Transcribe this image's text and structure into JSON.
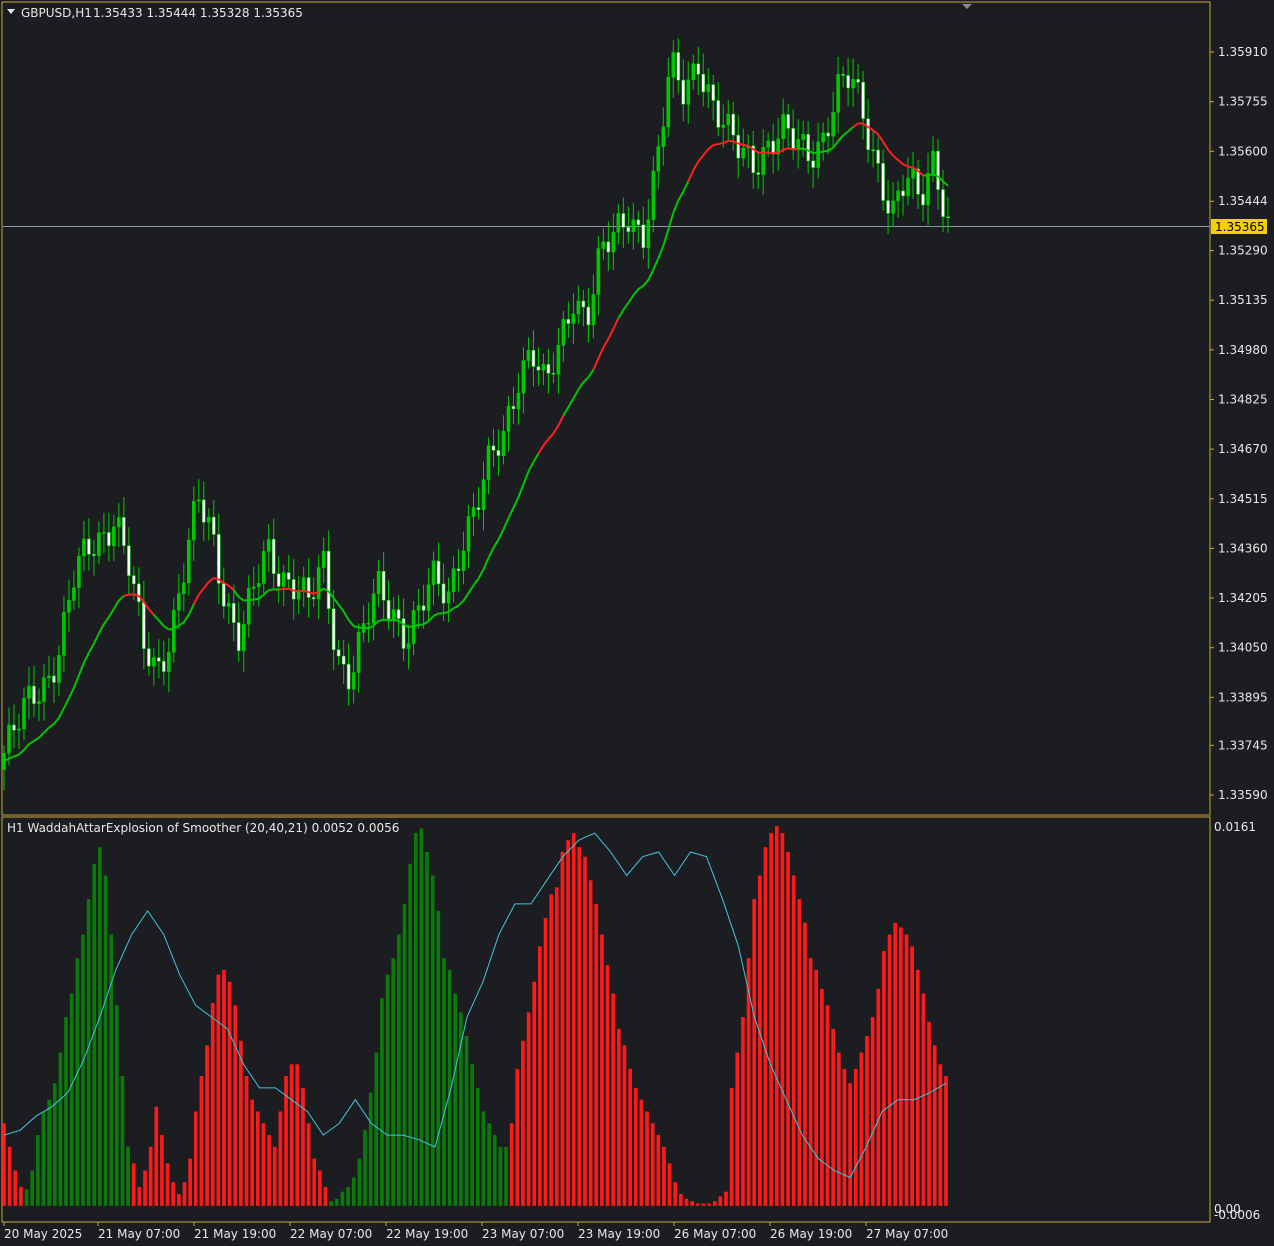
{
  "window": {
    "symbol_label": "GBPUSD,H1",
    "ohlc_label": "1.35433 1.35444 1.35328 1.35365",
    "collapse_icon": "triangle-down-icon",
    "scroll_marker_icon": "triangle-down-icon"
  },
  "colors": {
    "background": "#1c1d21",
    "frame": "#c8a83a",
    "candle_bull": "#00c800",
    "candle_bear": "#ffffff",
    "ma_up": "#00c800",
    "ma_down": "#ff2020",
    "hist_up": "#0a7a0a",
    "hist_down": "#ff1a1a",
    "signal_line": "#3fc6e0",
    "price_line": "#8c98a8",
    "price_tag_bg": "#f5d000"
  },
  "current_price": "1.35365",
  "indicator": {
    "label": "H1  WaddahAttarExplosion of Smoother (20,40,21) 0.0052 0.0056",
    "axis_top": "0.0161",
    "axis_zero": "0.00",
    "axis_bottom": "-0.0006"
  },
  "time_labels": [
    "20 May 2025",
    "21 May 07:00",
    "21 May 19:00",
    "22 May 07:00",
    "22 May 19:00",
    "23 May 07:00",
    "23 May 19:00",
    "26 May 07:00",
    "26 May 19:00",
    "27 May 07:00"
  ],
  "chart_data": [
    {
      "type": "candlestick",
      "title": "GBPUSD,H1",
      "timeframe": "H1",
      "price_ticks": [
        "1.35910",
        "1.35755",
        "1.35600",
        "1.35444",
        "1.35290",
        "1.35135",
        "1.34980",
        "1.34825",
        "1.34670",
        "1.34515",
        "1.34360",
        "1.34205",
        "1.34050",
        "1.33895",
        "1.33745",
        "1.33590"
      ],
      "ylim": [
        1.3354,
        1.36
      ],
      "last_price": 1.35365,
      "x_labels": [
        "20 May 2025",
        "21 May 07:00",
        "21 May 19:00",
        "22 May 07:00",
        "22 May 19:00",
        "23 May 07:00",
        "23 May 19:00",
        "26 May 07:00",
        "26 May 19:00",
        "27 May 07:00"
      ],
      "close_path": [
        1.3372,
        1.338,
        1.339,
        1.3395,
        1.3405,
        1.3425,
        1.3435,
        1.344,
        1.3447,
        1.343,
        1.3405,
        1.3398,
        1.341,
        1.343,
        1.345,
        1.344,
        1.342,
        1.3408,
        1.3422,
        1.3435,
        1.3428,
        1.3426,
        1.3418,
        1.343,
        1.3402,
        1.3398,
        1.3412,
        1.3422,
        1.3416,
        1.341,
        1.3418,
        1.3425,
        1.342,
        1.344,
        1.345,
        1.3462,
        1.347,
        1.349,
        1.35,
        1.3485,
        1.3497,
        1.3515,
        1.351,
        1.3528,
        1.3532,
        1.354,
        1.3535,
        1.3555,
        1.3585,
        1.3578,
        1.359,
        1.3575,
        1.3565,
        1.356,
        1.3558,
        1.3562,
        1.3565,
        1.3562,
        1.356,
        1.3565,
        1.3578,
        1.3582,
        1.357,
        1.3555,
        1.354,
        1.355,
        1.3545,
        1.356,
        1.3537
      ],
      "ma_colors": [
        "up",
        "up",
        "up",
        "up",
        "up",
        "up",
        "up",
        "up",
        "up",
        "down",
        "down",
        "up",
        "up",
        "up",
        "down",
        "down",
        "down",
        "up",
        "up",
        "up",
        "down",
        "down",
        "down",
        "up",
        "up",
        "up",
        "up",
        "up",
        "up",
        "up",
        "up",
        "up",
        "up",
        "up",
        "up",
        "up",
        "up",
        "up",
        "up",
        "down",
        "down",
        "up",
        "up",
        "down",
        "down",
        "up",
        "up",
        "up",
        "up",
        "up",
        "down",
        "down",
        "down",
        "down",
        "down",
        "down",
        "down",
        "down",
        "up",
        "up",
        "up",
        "up",
        "down",
        "down",
        "down",
        "down",
        "down",
        "up",
        "up"
      ]
    },
    {
      "type": "bar",
      "title": "WaddahAttarExplosion of Smoother (20,40,21)",
      "ylim": [
        -0.0006,
        0.0161
      ],
      "hist": [
        0.0035,
        0.0025,
        0.0015,
        0.0008,
        0.0007,
        0.0015,
        0.003,
        0.004,
        0.0045,
        0.0052,
        0.0065,
        0.008,
        0.009,
        0.0105,
        0.0115,
        0.013,
        0.0145,
        0.0152,
        0.014,
        0.0115,
        0.0085,
        0.0055,
        0.0025,
        0.0018,
        0.0008,
        0.0015,
        0.0025,
        0.0042,
        0.003,
        0.0018,
        0.001,
        0.0005,
        0.001,
        0.002,
        0.004,
        0.0055,
        0.0068,
        0.0086,
        0.0098,
        0.01,
        0.0095,
        0.0085,
        0.007,
        0.0055,
        0.0045,
        0.004,
        0.0035,
        0.003,
        0.0025,
        0.004,
        0.0055,
        0.006,
        0.006,
        0.005,
        0.0035,
        0.002,
        0.0015,
        0.0008,
        0.0002,
        0.0003,
        0.0006,
        0.0008,
        0.0012,
        0.002,
        0.0032,
        0.0048,
        0.0065,
        0.0088,
        0.0098,
        0.0105,
        0.0115,
        0.0128,
        0.0145,
        0.0158,
        0.016,
        0.015,
        0.014,
        0.0125,
        0.0105,
        0.01,
        0.009,
        0.0082,
        0.0072,
        0.006,
        0.005,
        0.004,
        0.0035,
        0.003,
        0.0025,
        0.0025,
        0.0035,
        0.0058,
        0.007,
        0.0082,
        0.0095,
        0.011,
        0.0122,
        0.0132,
        0.0135,
        0.015,
        0.0155,
        0.0158,
        0.0152,
        0.0148,
        0.0138,
        0.0128,
        0.0115,
        0.0102,
        0.009,
        0.0075,
        0.0068,
        0.0058,
        0.005,
        0.0045,
        0.004,
        0.0035,
        0.003,
        0.0025,
        0.0018,
        0.001,
        0.0005,
        0.0003,
        0.0002,
        0.0001,
        0.0001,
        0.0001,
        0.0002,
        0.0004,
        0.0006,
        0.005,
        0.0065,
        0.008,
        0.0105,
        0.013,
        0.014,
        0.0152,
        0.0158,
        0.0161,
        0.0158,
        0.015,
        0.014,
        0.013,
        0.012,
        0.0105,
        0.01,
        0.0092,
        0.0085,
        0.0075,
        0.0065,
        0.0058,
        0.0052,
        0.0058,
        0.0065,
        0.0072,
        0.008,
        0.0092,
        0.0108,
        0.0115,
        0.012,
        0.0118,
        0.0115,
        0.011,
        0.01,
        0.009,
        0.0078,
        0.0068,
        0.006,
        0.0055
      ],
      "hist_colors": [
        "down",
        "down",
        "down",
        "down",
        "up",
        "up",
        "up",
        "up",
        "up",
        "up",
        "up",
        "up",
        "up",
        "up",
        "up",
        "up",
        "up",
        "up",
        "up",
        "up",
        "up",
        "up",
        "up",
        "down",
        "down",
        "down",
        "down",
        "down",
        "down",
        "down",
        "down",
        "down",
        "down",
        "down",
        "down",
        "down",
        "down",
        "down",
        "down",
        "down",
        "down",
        "down",
        "down",
        "down",
        "down",
        "down",
        "down",
        "down",
        "down",
        "down",
        "down",
        "down",
        "down",
        "down",
        "down",
        "down",
        "down",
        "down",
        "up",
        "up",
        "up",
        "up",
        "up",
        "up",
        "up",
        "up",
        "up",
        "up",
        "up",
        "up",
        "up",
        "up",
        "up",
        "up",
        "up",
        "up",
        "up",
        "up",
        "up",
        "up",
        "up",
        "up",
        "up",
        "up",
        "up",
        "up",
        "up",
        "up",
        "up",
        "up",
        "up",
        "down",
        "down",
        "down",
        "down",
        "down",
        "down",
        "down",
        "down",
        "down",
        "down",
        "down",
        "down",
        "down",
        "down",
        "down",
        "down",
        "down",
        "down",
        "down",
        "down",
        "down",
        "down",
        "down",
        "down",
        "down",
        "down",
        "down",
        "down",
        "down",
        "down",
        "down",
        "down",
        "down",
        "down",
        "down",
        "down",
        "down",
        "down",
        "down",
        "down",
        "down",
        "down",
        "down",
        "down",
        "down",
        "down",
        "down",
        "down",
        "down",
        "down",
        "down",
        "down",
        "down",
        "down",
        "down",
        "down",
        "down",
        "down",
        "down",
        "down",
        "down",
        "down",
        "down",
        "down",
        "down",
        "down",
        "down",
        "down",
        "down",
        "down",
        "down",
        "down",
        "down",
        "down",
        "down",
        "down",
        "down",
        "down",
        "down"
      ],
      "signal": [
        0.003,
        0.0032,
        0.0038,
        0.0042,
        0.0048,
        0.0062,
        0.008,
        0.01,
        0.0115,
        0.0125,
        0.0115,
        0.0098,
        0.0085,
        0.008,
        0.0075,
        0.006,
        0.005,
        0.005,
        0.0045,
        0.004,
        0.003,
        0.0035,
        0.0045,
        0.0035,
        0.003,
        0.003,
        0.0028,
        0.0025,
        0.005,
        0.008,
        0.0095,
        0.0115,
        0.0128,
        0.0128,
        0.0138,
        0.0148,
        0.0155,
        0.0158,
        0.015,
        0.014,
        0.0148,
        0.015,
        0.014,
        0.015,
        0.0148,
        0.013,
        0.011,
        0.008,
        0.006,
        0.0045,
        0.003,
        0.002,
        0.0015,
        0.0012,
        0.0025,
        0.004,
        0.0045,
        0.0045,
        0.0048,
        0.0052
      ]
    }
  ]
}
